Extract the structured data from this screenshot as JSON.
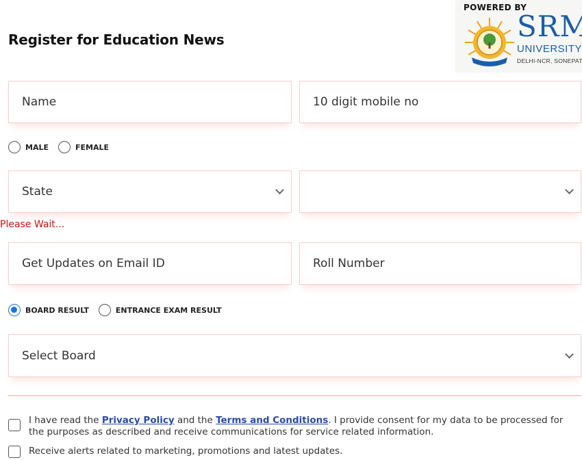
{
  "header": {
    "title": "Register for Education News",
    "logo": {
      "powered_by": "POWERED BY",
      "name": "SRM",
      "subtitle": "UNIVERSITY",
      "campus": "DELHI-NCR, SONEPAT",
      "brand_color": "#1a5ea8"
    }
  },
  "form": {
    "name_placeholder": "Name",
    "mobile_placeholder": "10 digit mobile no",
    "gender": {
      "options": [
        {
          "label": "MALE",
          "checked": false
        },
        {
          "label": "FEMALE",
          "checked": false
        }
      ]
    },
    "state_select": {
      "value": "State"
    },
    "city_select": {
      "value": ""
    },
    "wait_message": "Please Wait...",
    "email_placeholder": "Get Updates on Email ID",
    "roll_placeholder": "Roll Number",
    "result_type": {
      "options": [
        {
          "label": "BOARD RESULT",
          "checked": true
        },
        {
          "label": "ENTRANCE EXAM RESULT",
          "checked": false
        }
      ]
    },
    "board_select": {
      "value": "Select Board"
    },
    "consent": {
      "part1": "I have read the ",
      "privacy_link": "Privacy Policy",
      "part2": " and the ",
      "terms_link": "Terms and Conditions",
      "part3": ". I provide consent for my data to be processed for the purposes as described and receive communications for service related information."
    },
    "marketing_consent": "Receive alerts related to marketing, promotions and latest updates."
  },
  "colors": {
    "border": "#f3cfca",
    "accent": "#1a73e8",
    "error": "#d01010",
    "link": "#2a4aa8"
  }
}
